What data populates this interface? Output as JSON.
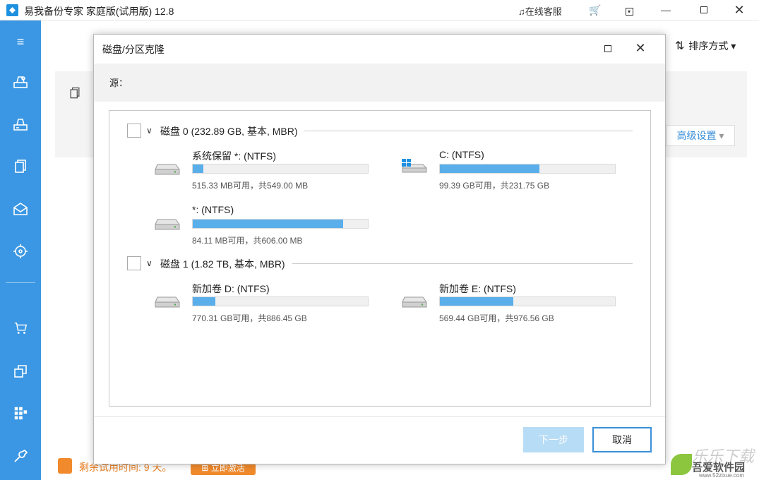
{
  "app": {
    "title": "易我备份专家 家庭版(试用版) 12.8",
    "support": "在线客服"
  },
  "main": {
    "sort_label": "排序方式",
    "advanced_label": "高级设置",
    "trial_text": "剩余试用时间: 9 天。",
    "activate_label": "立即激活"
  },
  "dialog": {
    "title": "磁盘/分区克隆",
    "source_label": "源：",
    "next_label": "下一步",
    "cancel_label": "取消",
    "disks": [
      {
        "label": "磁盘 0 (232.89 GB, 基本, MBR)",
        "partitions": [
          {
            "name": "系统保留 *: (NTFS)",
            "info": "515.33 MB可用，共549.00 MB",
            "used_fraction": 0.06,
            "icon": "drive-icon"
          },
          {
            "name": "C: (NTFS)",
            "info": "99.39 GB可用，共231.75 GB",
            "used_fraction": 0.57,
            "icon": "windows-drive-icon"
          },
          {
            "name": "*: (NTFS)",
            "info": "84.11 MB可用，共606.00 MB",
            "used_fraction": 0.86,
            "icon": "drive-icon"
          }
        ]
      },
      {
        "label": "磁盘 1 (1.82 TB, 基本, MBR)",
        "partitions": [
          {
            "name": "新加卷 D: (NTFS)",
            "info": "770.31 GB可用，共886.45 GB",
            "used_fraction": 0.13,
            "icon": "drive-icon"
          },
          {
            "name": "新加卷 E: (NTFS)",
            "info": "569.44 GB可用，共976.56 GB",
            "used_fraction": 0.42,
            "icon": "drive-icon"
          }
        ]
      }
    ]
  },
  "watermark": {
    "line1": "乐乐下载",
    "line2": "吾爱软件园",
    "line3": "www.52zixue.com"
  },
  "colors": {
    "sidebar": "#3b97e3",
    "accent": "#3b8fd9",
    "bar_fill": "#5aaeea",
    "trial": "#e67e22"
  }
}
